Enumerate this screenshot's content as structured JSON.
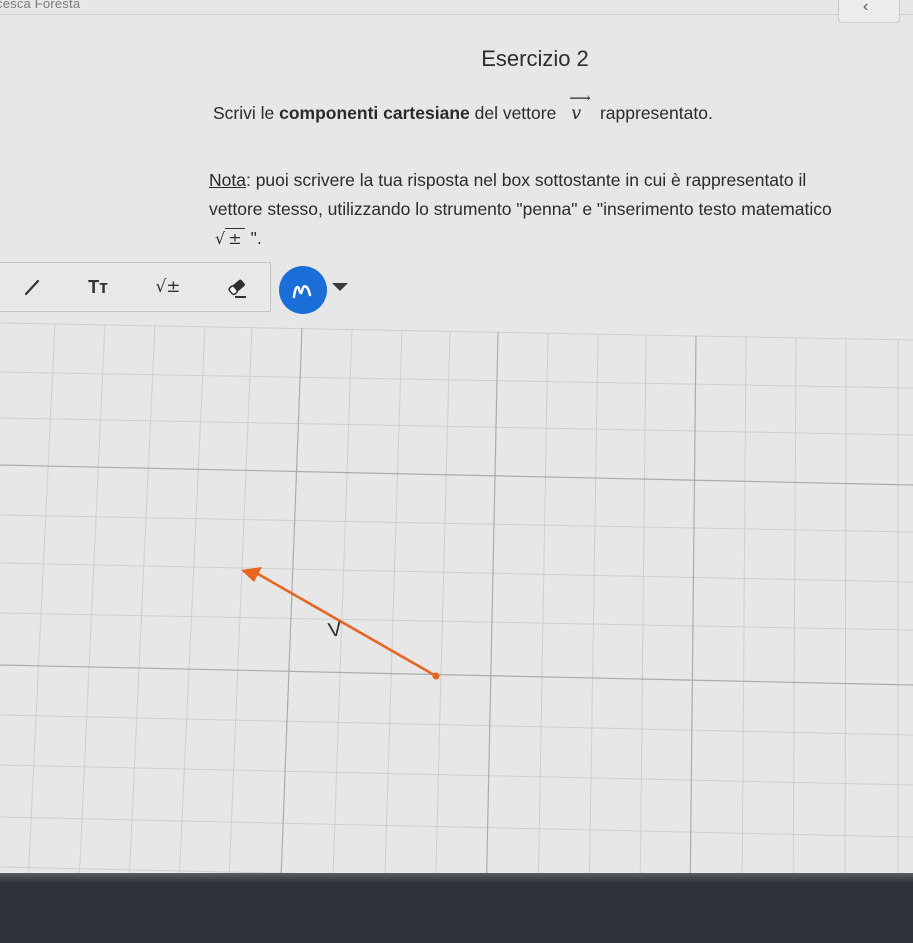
{
  "header": {
    "user_name": "cesca Foresta",
    "collapse_icon": "chevron-left-icon"
  },
  "exercise": {
    "title": "Esercizio 2",
    "instruction_pre": "Scrivi le ",
    "instruction_bold": "componenti cartesiane",
    "instruction_mid": " del vettore",
    "vector_symbol": "v",
    "instruction_post": "rappresentato.",
    "note_label": "Nota",
    "note_text1": ": puoi scrivere la tua risposta nel box sottostante in cui è rappresentato il vettore stesso, utilizzando lo strumento \"penna\" e \"inserimento testo matematico",
    "note_sqrt": "±",
    "note_text2": "\"."
  },
  "toolbar": {
    "tools": [
      {
        "name": "pen-tool",
        "icon": "pen-icon"
      },
      {
        "name": "text-tool",
        "label": "Tт"
      },
      {
        "name": "math-tool",
        "label": "√±"
      },
      {
        "name": "eraser-tool",
        "icon": "eraser-icon"
      }
    ],
    "draw_button_icon": "pen-stroke-icon",
    "dropdown_icon": "caret-down-icon",
    "accent_color": "#1a6ed8"
  },
  "canvas": {
    "vector_label": "V",
    "vector_color": "#e8651f"
  }
}
